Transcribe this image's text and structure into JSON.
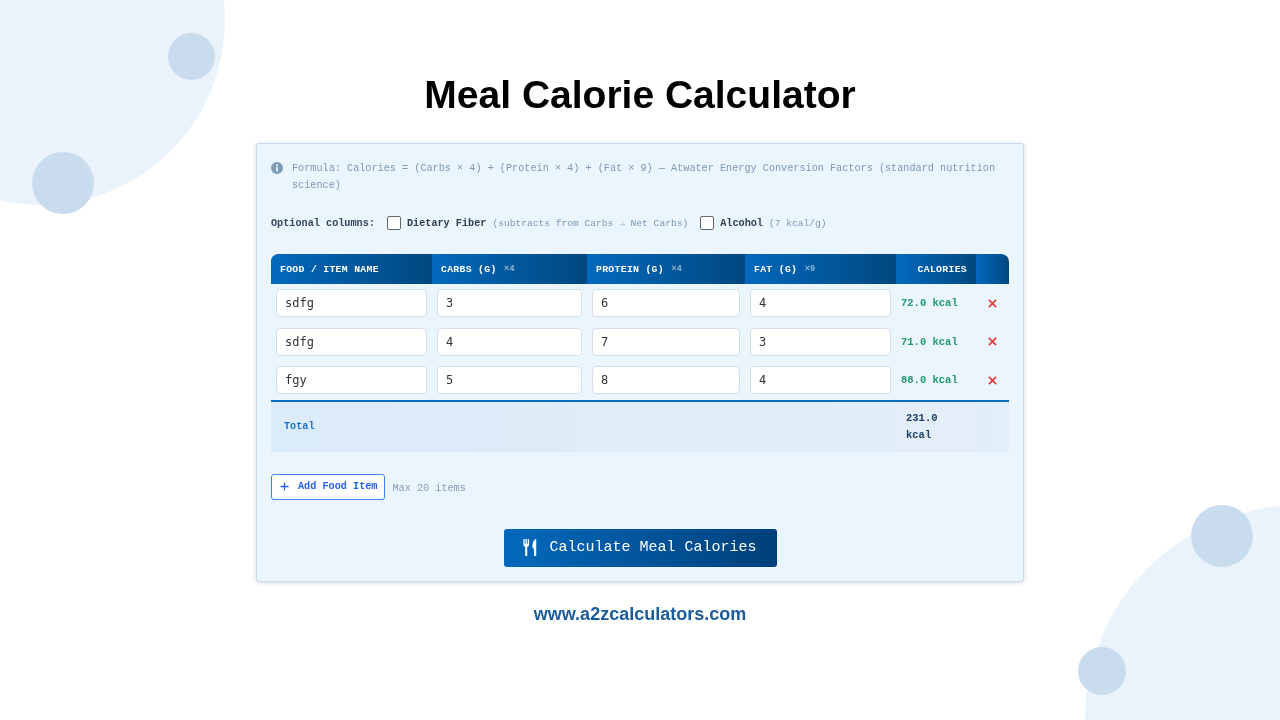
{
  "title": "Meal Calorie Calculator",
  "formula": "Formula: Calories = (Carbs × 4) + (Protein × 4) + (Fat × 9) — Atwater Energy Conversion Factors (standard nutrition science)",
  "optional_columns": {
    "label": "Optional columns:",
    "options": [
      {
        "label": "Dietary Fiber",
        "hint": "(subtracts from Carbs → Net Carbs)",
        "checked": false
      },
      {
        "label": "Alcohol",
        "hint": "(7 kcal/g)",
        "checked": false
      }
    ]
  },
  "table": {
    "columns": [
      {
        "label": "FOOD / ITEM NAME"
      },
      {
        "label": "CARBS (G)",
        "factor": "×4"
      },
      {
        "label": "PROTEIN (G)",
        "factor": "×4"
      },
      {
        "label": "FAT (G)",
        "factor": "×9"
      },
      {
        "label": "CALORIES"
      }
    ],
    "rows": [
      {
        "name": "sdfg",
        "carbs": "3",
        "protein": "6",
        "fat": "4",
        "calories": "72.0 kcal"
      },
      {
        "name": "sdfg",
        "carbs": "4",
        "protein": "7",
        "fat": "3",
        "calories": "71.0 kcal"
      },
      {
        "name": "fgy",
        "carbs": "5",
        "protein": "8",
        "fat": "4",
        "calories": "88.0 kcal"
      }
    ],
    "total": {
      "label": "Total",
      "calories": "231.0 kcal"
    }
  },
  "add_button": "Add Food Item",
  "limit_note": "Max 20 items",
  "calculate_button": "Calculate Meal Calories",
  "footer": "www.a2zcalculators.com"
}
